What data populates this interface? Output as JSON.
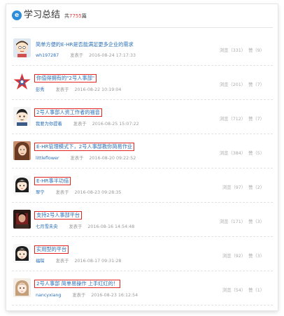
{
  "header": {
    "logo_glyph": "e",
    "title": "学习总结",
    "count_prefix": "共",
    "count_num": "7755",
    "count_suffix": "篇"
  },
  "accent_color": "#2a6fb8",
  "highlight_color": "#e1241f",
  "items": [
    {
      "title": "简单方便的E-HR是否能满足更多企业的需求",
      "author": "wh197287",
      "posted_label": "发表于",
      "date": "2016-08-24 17:17:33",
      "views": "浏览（331）",
      "likes": "赞（9）",
      "avatar": "cartoon-boy-avatar"
    },
    {
      "title": "你值得拥有的\"2号人事部\"",
      "author": "彭秀",
      "posted_label": "发表于",
      "date": "2016-08-22 10:19:04",
      "views": "浏览（201）",
      "likes": "赞（7）",
      "avatar": "star-logo-avatar"
    },
    {
      "title": "2号人事部人资工作者的福音",
      "author": "我要为你提着",
      "posted_label": "发表于",
      "date": "2016-08-25 15:07:22",
      "views": "浏览（712）",
      "likes": "赞（7）",
      "avatar": "cartoon-man-avatar"
    },
    {
      "title": "E-HR管理模式下，2号人事部教你简易作业",
      "author": "littleflower",
      "posted_label": "发表于",
      "date": "2016-08-20 09:22:52",
      "views": "浏览（384）",
      "likes": "赞（5）",
      "avatar": "woman-photo-avatar"
    },
    {
      "title": "E-HR事半功倍",
      "author": "翠宁",
      "posted_label": "发表于",
      "date": "2016-08-23 09:28:35",
      "views": "浏览（97）",
      "likes": "赞（2）",
      "avatar": "cartoon-girl-avatar"
    },
    {
      "title": "支持2号人事部平台",
      "author": "七月雪未央",
      "posted_label": "发表于",
      "date": "2016-08-16 14:54:48",
      "views": "浏览（171）",
      "likes": "赞（3）",
      "avatar": "dark-photo-avatar"
    },
    {
      "title": "实用型的平台",
      "author": "福琛",
      "posted_label": "发表于",
      "date": "2016-08-17 09:31:28",
      "views": "浏览（92）",
      "likes": "赞（3）",
      "avatar": "cartoon-girl-avatar-2"
    },
    {
      "title": "2号人事部 简单易操作 上手红红的！",
      "author": "nancyxiang",
      "posted_label": "发表于",
      "date": "2016-08-23 16:12:54",
      "views": "浏览（54）",
      "likes": "赞（1）",
      "avatar": "anime-girl-avatar"
    }
  ]
}
